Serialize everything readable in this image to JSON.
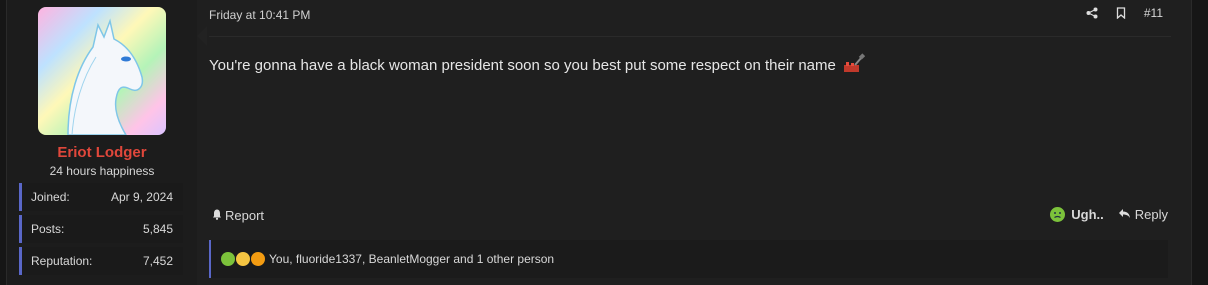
{
  "user": {
    "name": "Eriot Lodger",
    "title": "24 hours happiness",
    "stats": [
      {
        "label": "Joined:",
        "value": "Apr 9, 2024"
      },
      {
        "label": "Posts:",
        "value": "5,845"
      },
      {
        "label": "Reputation:",
        "value": "7,452"
      }
    ]
  },
  "post": {
    "date": "Friday at 10:41 PM",
    "number": "#11",
    "body": "You're gonna have a black woman president soon so you best put some respect on their name",
    "report_label": "Report",
    "reaction_label": "Ugh..",
    "reply_label": "Reply",
    "reactions_text": "You, fluoride1337, BeanletMogger and 1 other person"
  },
  "colors": {
    "username": "#e0473b",
    "accent": "#5a67c8"
  },
  "icons": [
    "share-icon",
    "bookmark-icon",
    "bell-icon",
    "sick-emoji-icon",
    "reply-arrow-icon",
    "hammer-icon"
  ]
}
